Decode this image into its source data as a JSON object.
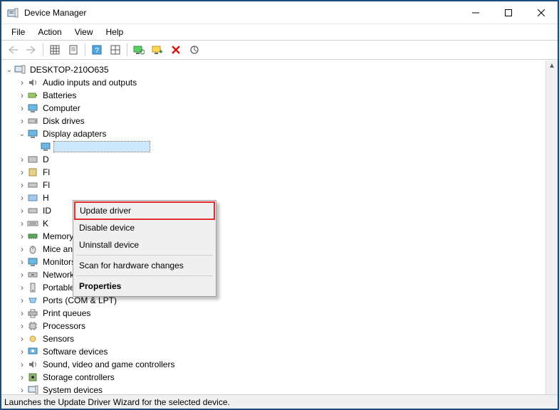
{
  "window": {
    "title": "Device Manager"
  },
  "menubar": [
    "File",
    "Action",
    "View",
    "Help"
  ],
  "tree": {
    "root": {
      "label": "DESKTOP-210O635"
    },
    "items": [
      {
        "label": "Audio inputs and outputs"
      },
      {
        "label": "Batteries"
      },
      {
        "label": "Computer"
      },
      {
        "label": "Disk drives"
      },
      {
        "label": "Display adapters",
        "expanded": true
      },
      {
        "label": "D"
      },
      {
        "label": "Fl"
      },
      {
        "label": "Fl"
      },
      {
        "label": "H"
      },
      {
        "label": "ID"
      },
      {
        "label": "K"
      },
      {
        "label": "Memory devices"
      },
      {
        "label": "Mice and other pointing devices"
      },
      {
        "label": "Monitors"
      },
      {
        "label": "Network adapters"
      },
      {
        "label": "Portable Devices"
      },
      {
        "label": "Ports (COM & LPT)"
      },
      {
        "label": "Print queues"
      },
      {
        "label": "Processors"
      },
      {
        "label": "Sensors"
      },
      {
        "label": "Software devices"
      },
      {
        "label": "Sound, video and game controllers"
      },
      {
        "label": "Storage controllers"
      },
      {
        "label": "System devices"
      }
    ]
  },
  "context_menu": {
    "items": [
      "Update driver",
      "Disable device",
      "Uninstall device",
      "Scan for hardware changes",
      "Properties"
    ]
  },
  "statusbar": {
    "text": "Launches the Update Driver Wizard for the selected device."
  }
}
